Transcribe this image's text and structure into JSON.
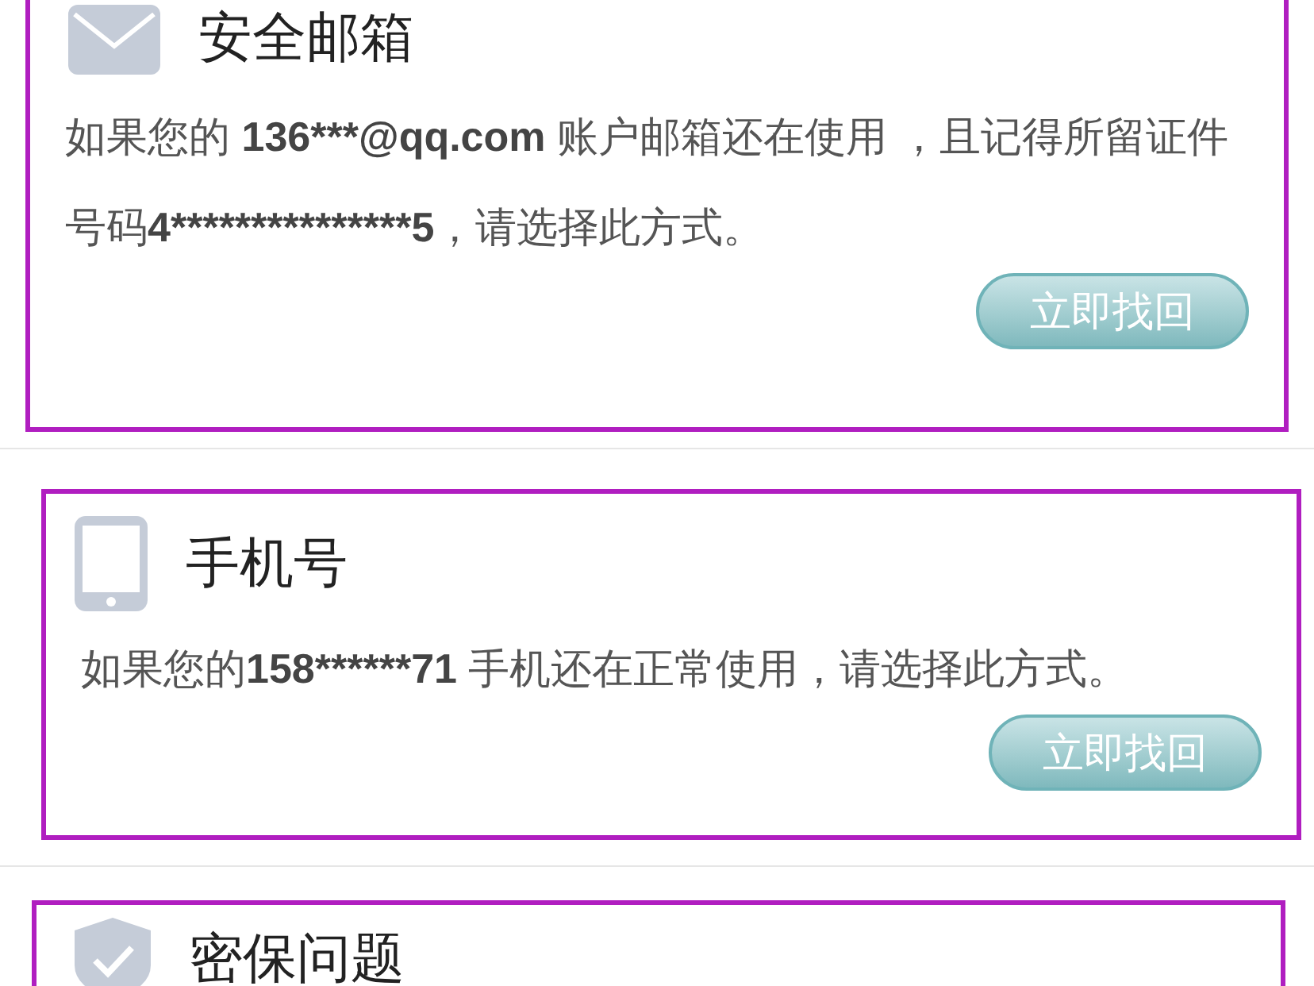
{
  "methods": [
    {
      "kind": "email",
      "title": "安全邮箱",
      "description": [
        {
          "text": "如果您的 ",
          "bold": false
        },
        {
          "text": "136***@qq.com",
          "bold": true
        },
        {
          "text": " 账户邮箱还在使用 ，且记得所留证件号码",
          "bold": false
        },
        {
          "text": "4***************5",
          "bold": true
        },
        {
          "text": "，请选择此方式。",
          "bold": false
        }
      ],
      "button": "立即找回"
    },
    {
      "kind": "phone",
      "title": "手机号",
      "description": [
        {
          "text": "如果您的",
          "bold": false
        },
        {
          "text": "158******71",
          "bold": true
        },
        {
          "text": " 手机还在正常使用，请选择此方式。",
          "bold": false
        }
      ],
      "button": "立即找回"
    },
    {
      "kind": "question",
      "title": "密保问题"
    }
  ]
}
